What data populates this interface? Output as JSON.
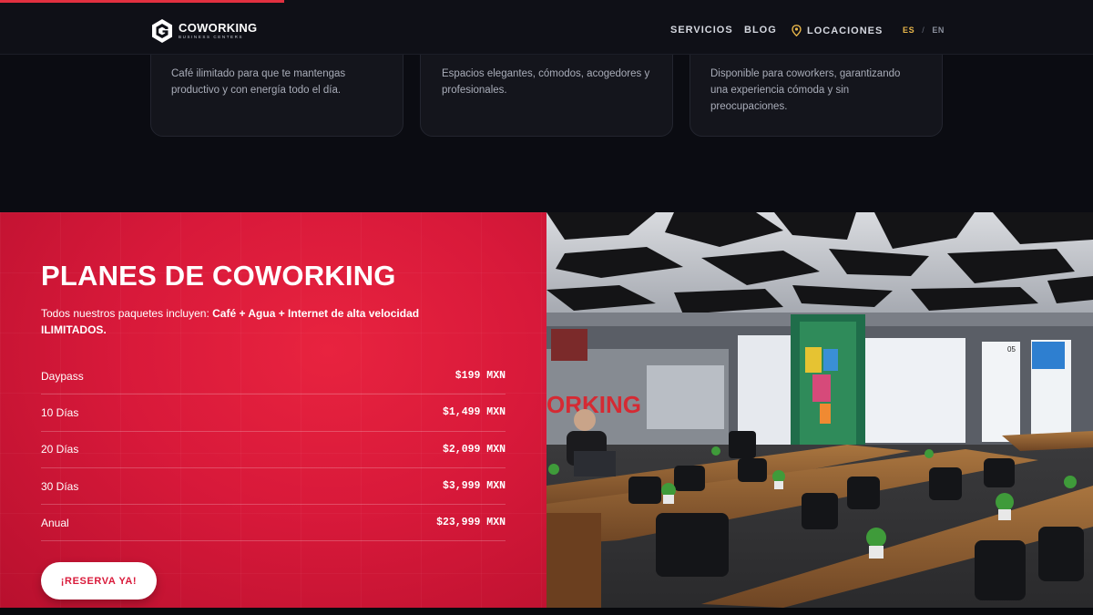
{
  "progress": {
    "fraction": 0.26,
    "color": "#e23040"
  },
  "header": {
    "logo": {
      "name": "COWORKING",
      "tagline": "BUSINESS CENTERS"
    },
    "nav": {
      "servicios": "SERVICIOS",
      "blog": "BLOG",
      "locaciones": "LOCACIONES",
      "locaciones_icon": "location-pin-icon"
    },
    "lang": {
      "active": "ES",
      "separator": "/",
      "other": "EN"
    }
  },
  "cards": [
    {
      "text": "Café ilimitado para que te mantengas productivo y con energía todo el día."
    },
    {
      "text": "Espacios elegantes, cómodos, acogedores y profesionales."
    },
    {
      "text": "Disponible para coworkers, garantizando una experiencia cómoda y sin preocupaciones."
    }
  ],
  "plans": {
    "title": "PLANES DE COWORKING",
    "intro_prefix": "Todos nuestros paquetes incluyen: ",
    "intro_bold": "Café + Agua + Internet de alta velocidad ILIMITADOS.",
    "rows": [
      {
        "name": "Daypass",
        "price": "$199 MXN"
      },
      {
        "name": "10 Días",
        "price": "$1,499 MXN"
      },
      {
        "name": "20 Días",
        "price": "$2,099 MXN"
      },
      {
        "name": "30 Días",
        "price": "$3,999 MXN"
      },
      {
        "name": "Anual",
        "price": "$23,999 MXN"
      }
    ],
    "button": "¡RESERVA YA!"
  },
  "photo": {
    "wall_text": "ORKING",
    "door_number": "05"
  },
  "colors": {
    "accent_red": "#d91a3a",
    "lang_active": "#e8b64a",
    "background": "#0b0c12"
  }
}
